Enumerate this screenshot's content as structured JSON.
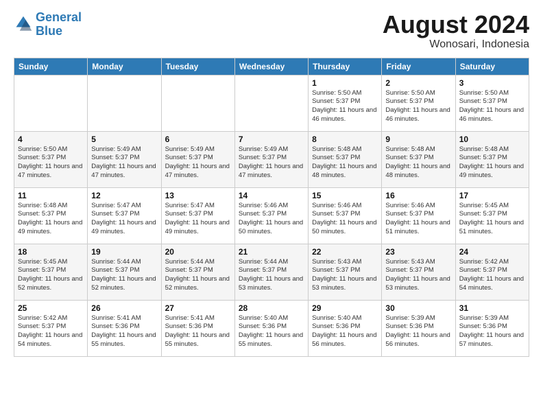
{
  "header": {
    "logo_line1": "General",
    "logo_line2": "Blue",
    "month_title": "August 2024",
    "location": "Wonosari, Indonesia"
  },
  "days_of_week": [
    "Sunday",
    "Monday",
    "Tuesday",
    "Wednesday",
    "Thursday",
    "Friday",
    "Saturday"
  ],
  "weeks": [
    [
      {
        "day": "",
        "sunrise": "",
        "sunset": "",
        "daylight": ""
      },
      {
        "day": "",
        "sunrise": "",
        "sunset": "",
        "daylight": ""
      },
      {
        "day": "",
        "sunrise": "",
        "sunset": "",
        "daylight": ""
      },
      {
        "day": "",
        "sunrise": "",
        "sunset": "",
        "daylight": ""
      },
      {
        "day": "1",
        "sunrise": "Sunrise: 5:50 AM",
        "sunset": "Sunset: 5:37 PM",
        "daylight": "Daylight: 11 hours and 46 minutes."
      },
      {
        "day": "2",
        "sunrise": "Sunrise: 5:50 AM",
        "sunset": "Sunset: 5:37 PM",
        "daylight": "Daylight: 11 hours and 46 minutes."
      },
      {
        "day": "3",
        "sunrise": "Sunrise: 5:50 AM",
        "sunset": "Sunset: 5:37 PM",
        "daylight": "Daylight: 11 hours and 46 minutes."
      }
    ],
    [
      {
        "day": "4",
        "sunrise": "Sunrise: 5:50 AM",
        "sunset": "Sunset: 5:37 PM",
        "daylight": "Daylight: 11 hours and 47 minutes."
      },
      {
        "day": "5",
        "sunrise": "Sunrise: 5:49 AM",
        "sunset": "Sunset: 5:37 PM",
        "daylight": "Daylight: 11 hours and 47 minutes."
      },
      {
        "day": "6",
        "sunrise": "Sunrise: 5:49 AM",
        "sunset": "Sunset: 5:37 PM",
        "daylight": "Daylight: 11 hours and 47 minutes."
      },
      {
        "day": "7",
        "sunrise": "Sunrise: 5:49 AM",
        "sunset": "Sunset: 5:37 PM",
        "daylight": "Daylight: 11 hours and 47 minutes."
      },
      {
        "day": "8",
        "sunrise": "Sunrise: 5:48 AM",
        "sunset": "Sunset: 5:37 PM",
        "daylight": "Daylight: 11 hours and 48 minutes."
      },
      {
        "day": "9",
        "sunrise": "Sunrise: 5:48 AM",
        "sunset": "Sunset: 5:37 PM",
        "daylight": "Daylight: 11 hours and 48 minutes."
      },
      {
        "day": "10",
        "sunrise": "Sunrise: 5:48 AM",
        "sunset": "Sunset: 5:37 PM",
        "daylight": "Daylight: 11 hours and 49 minutes."
      }
    ],
    [
      {
        "day": "11",
        "sunrise": "Sunrise: 5:48 AM",
        "sunset": "Sunset: 5:37 PM",
        "daylight": "Daylight: 11 hours and 49 minutes."
      },
      {
        "day": "12",
        "sunrise": "Sunrise: 5:47 AM",
        "sunset": "Sunset: 5:37 PM",
        "daylight": "Daylight: 11 hours and 49 minutes."
      },
      {
        "day": "13",
        "sunrise": "Sunrise: 5:47 AM",
        "sunset": "Sunset: 5:37 PM",
        "daylight": "Daylight: 11 hours and 49 minutes."
      },
      {
        "day": "14",
        "sunrise": "Sunrise: 5:46 AM",
        "sunset": "Sunset: 5:37 PM",
        "daylight": "Daylight: 11 hours and 50 minutes."
      },
      {
        "day": "15",
        "sunrise": "Sunrise: 5:46 AM",
        "sunset": "Sunset: 5:37 PM",
        "daylight": "Daylight: 11 hours and 50 minutes."
      },
      {
        "day": "16",
        "sunrise": "Sunrise: 5:46 AM",
        "sunset": "Sunset: 5:37 PM",
        "daylight": "Daylight: 11 hours and 51 minutes."
      },
      {
        "day": "17",
        "sunrise": "Sunrise: 5:45 AM",
        "sunset": "Sunset: 5:37 PM",
        "daylight": "Daylight: 11 hours and 51 minutes."
      }
    ],
    [
      {
        "day": "18",
        "sunrise": "Sunrise: 5:45 AM",
        "sunset": "Sunset: 5:37 PM",
        "daylight": "Daylight: 11 hours and 52 minutes."
      },
      {
        "day": "19",
        "sunrise": "Sunrise: 5:44 AM",
        "sunset": "Sunset: 5:37 PM",
        "daylight": "Daylight: 11 hours and 52 minutes."
      },
      {
        "day": "20",
        "sunrise": "Sunrise: 5:44 AM",
        "sunset": "Sunset: 5:37 PM",
        "daylight": "Daylight: 11 hours and 52 minutes."
      },
      {
        "day": "21",
        "sunrise": "Sunrise: 5:44 AM",
        "sunset": "Sunset: 5:37 PM",
        "daylight": "Daylight: 11 hours and 53 minutes."
      },
      {
        "day": "22",
        "sunrise": "Sunrise: 5:43 AM",
        "sunset": "Sunset: 5:37 PM",
        "daylight": "Daylight: 11 hours and 53 minutes."
      },
      {
        "day": "23",
        "sunrise": "Sunrise: 5:43 AM",
        "sunset": "Sunset: 5:37 PM",
        "daylight": "Daylight: 11 hours and 53 minutes."
      },
      {
        "day": "24",
        "sunrise": "Sunrise: 5:42 AM",
        "sunset": "Sunset: 5:37 PM",
        "daylight": "Daylight: 11 hours and 54 minutes."
      }
    ],
    [
      {
        "day": "25",
        "sunrise": "Sunrise: 5:42 AM",
        "sunset": "Sunset: 5:37 PM",
        "daylight": "Daylight: 11 hours and 54 minutes."
      },
      {
        "day": "26",
        "sunrise": "Sunrise: 5:41 AM",
        "sunset": "Sunset: 5:36 PM",
        "daylight": "Daylight: 11 hours and 55 minutes."
      },
      {
        "day": "27",
        "sunrise": "Sunrise: 5:41 AM",
        "sunset": "Sunset: 5:36 PM",
        "daylight": "Daylight: 11 hours and 55 minutes."
      },
      {
        "day": "28",
        "sunrise": "Sunrise: 5:40 AM",
        "sunset": "Sunset: 5:36 PM",
        "daylight": "Daylight: 11 hours and 55 minutes."
      },
      {
        "day": "29",
        "sunrise": "Sunrise: 5:40 AM",
        "sunset": "Sunset: 5:36 PM",
        "daylight": "Daylight: 11 hours and 56 minutes."
      },
      {
        "day": "30",
        "sunrise": "Sunrise: 5:39 AM",
        "sunset": "Sunset: 5:36 PM",
        "daylight": "Daylight: 11 hours and 56 minutes."
      },
      {
        "day": "31",
        "sunrise": "Sunrise: 5:39 AM",
        "sunset": "Sunset: 5:36 PM",
        "daylight": "Daylight: 11 hours and 57 minutes."
      }
    ]
  ]
}
